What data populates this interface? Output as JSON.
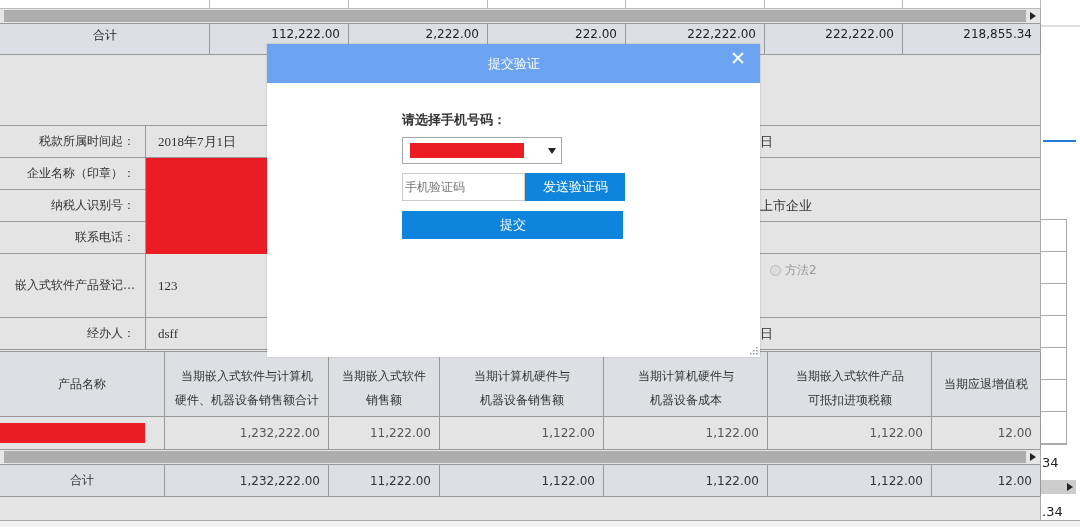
{
  "top_table": {
    "totals": [
      "合计",
      "112,222.00",
      "2,222.00",
      "222.00",
      "222,222.00",
      "222,222.00",
      "218,855.34"
    ]
  },
  "form": {
    "rows": [
      {
        "label": "税款所属时间起：",
        "value": "2018年7月1日",
        "right_text": "日"
      },
      {
        "label": "企业名称（印章）：",
        "redacted": true
      },
      {
        "label": "纳税人识别号：",
        "redacted": true,
        "right_text": "上市企业"
      },
      {
        "label": "联系电话：",
        "redacted": true
      },
      {
        "label": "嵌入式软件产品登记…",
        "value": "123",
        "tall": true,
        "radio": {
          "label": "方法2",
          "checked": false,
          "disabled": true
        }
      },
      {
        "label": "经办人：",
        "value": "dsff",
        "right_text": "日"
      }
    ]
  },
  "product_table": {
    "header_rows": [
      [
        {
          "text": "产品名称",
          "full_height": true
        },
        {
          "text": "当期嵌入式软件与计算机"
        },
        {
          "text": "当期嵌入式软件"
        },
        {
          "text": "当期计算机硬件与"
        },
        {
          "text": "当期计算机硬件与"
        },
        {
          "text": "当期嵌入式软件产品"
        },
        {
          "text": "当期应退增值税",
          "full_height": true
        }
      ],
      [
        {
          "text": "硬件、机器设备销售额合计"
        },
        {
          "text": "销售额"
        },
        {
          "text": "机器设备销售额"
        },
        {
          "text": "机器设备成本"
        },
        {
          "text": "可抵扣进项税额"
        }
      ]
    ],
    "rows": [
      {
        "product_redacted": true,
        "cells": [
          "",
          "1,232,222.00",
          "11,222.00",
          "1,122.00",
          "1,122.00",
          "1,122.00",
          "12.00"
        ]
      }
    ],
    "totals": [
      "合计",
      "1,232,222.00",
      "11,222.00",
      "1,122.00",
      "1,122.00",
      "1,122.00",
      "12.00"
    ]
  },
  "side_fragments": [
    "34",
    ".34"
  ],
  "dialog": {
    "title": "提交验证",
    "phone_label": "请选择手机号码：",
    "phone_redacted": true,
    "code_placeholder": "手机验证码",
    "send_button": "发送验证码",
    "submit_button": "提交"
  }
}
